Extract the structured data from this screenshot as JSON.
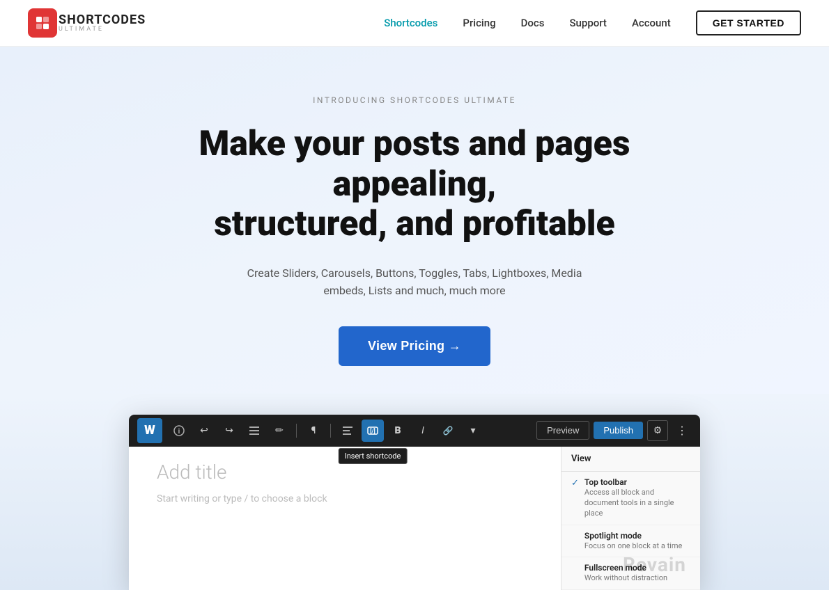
{
  "navbar": {
    "logo_main": "SHORTCODES",
    "logo_sub": "ULTIMATE",
    "nav_items": [
      {
        "label": "Shortcodes",
        "active": true
      },
      {
        "label": "Pricing",
        "active": false
      },
      {
        "label": "Docs",
        "active": false
      },
      {
        "label": "Support",
        "active": false
      },
      {
        "label": "Account",
        "active": false
      }
    ],
    "cta_label": "GET STARTED"
  },
  "hero": {
    "intro_text": "INTRODUCING SHORTCODES ULTIMATE",
    "title_line1": "Make your posts and pages appealing,",
    "title_line2": "structured, and profitable",
    "subtitle": "Create Sliders, Carousels, Buttons, Toggles, Tabs, Lightboxes, Media embeds, Lists and much, much more",
    "cta_label": "View Pricing →"
  },
  "editor": {
    "toolbar": {
      "tooltip_text": "Insert shortcode",
      "preview_label": "Preview",
      "publish_label": "Publish"
    },
    "content": {
      "add_title_placeholder": "Add title",
      "start_writing_placeholder": "Start writing or type / to choose a block"
    },
    "view_panel": {
      "header": "View",
      "items": [
        {
          "checked": true,
          "title": "Top toolbar",
          "desc": "Access all block and document tools in a single place"
        },
        {
          "checked": false,
          "title": "Spotlight mode",
          "desc": "Focus on one block at a time"
        },
        {
          "checked": false,
          "title": "Fullscreen mode",
          "desc": "Work without distraction"
        }
      ]
    }
  },
  "watermark": {
    "text": "Revain"
  }
}
